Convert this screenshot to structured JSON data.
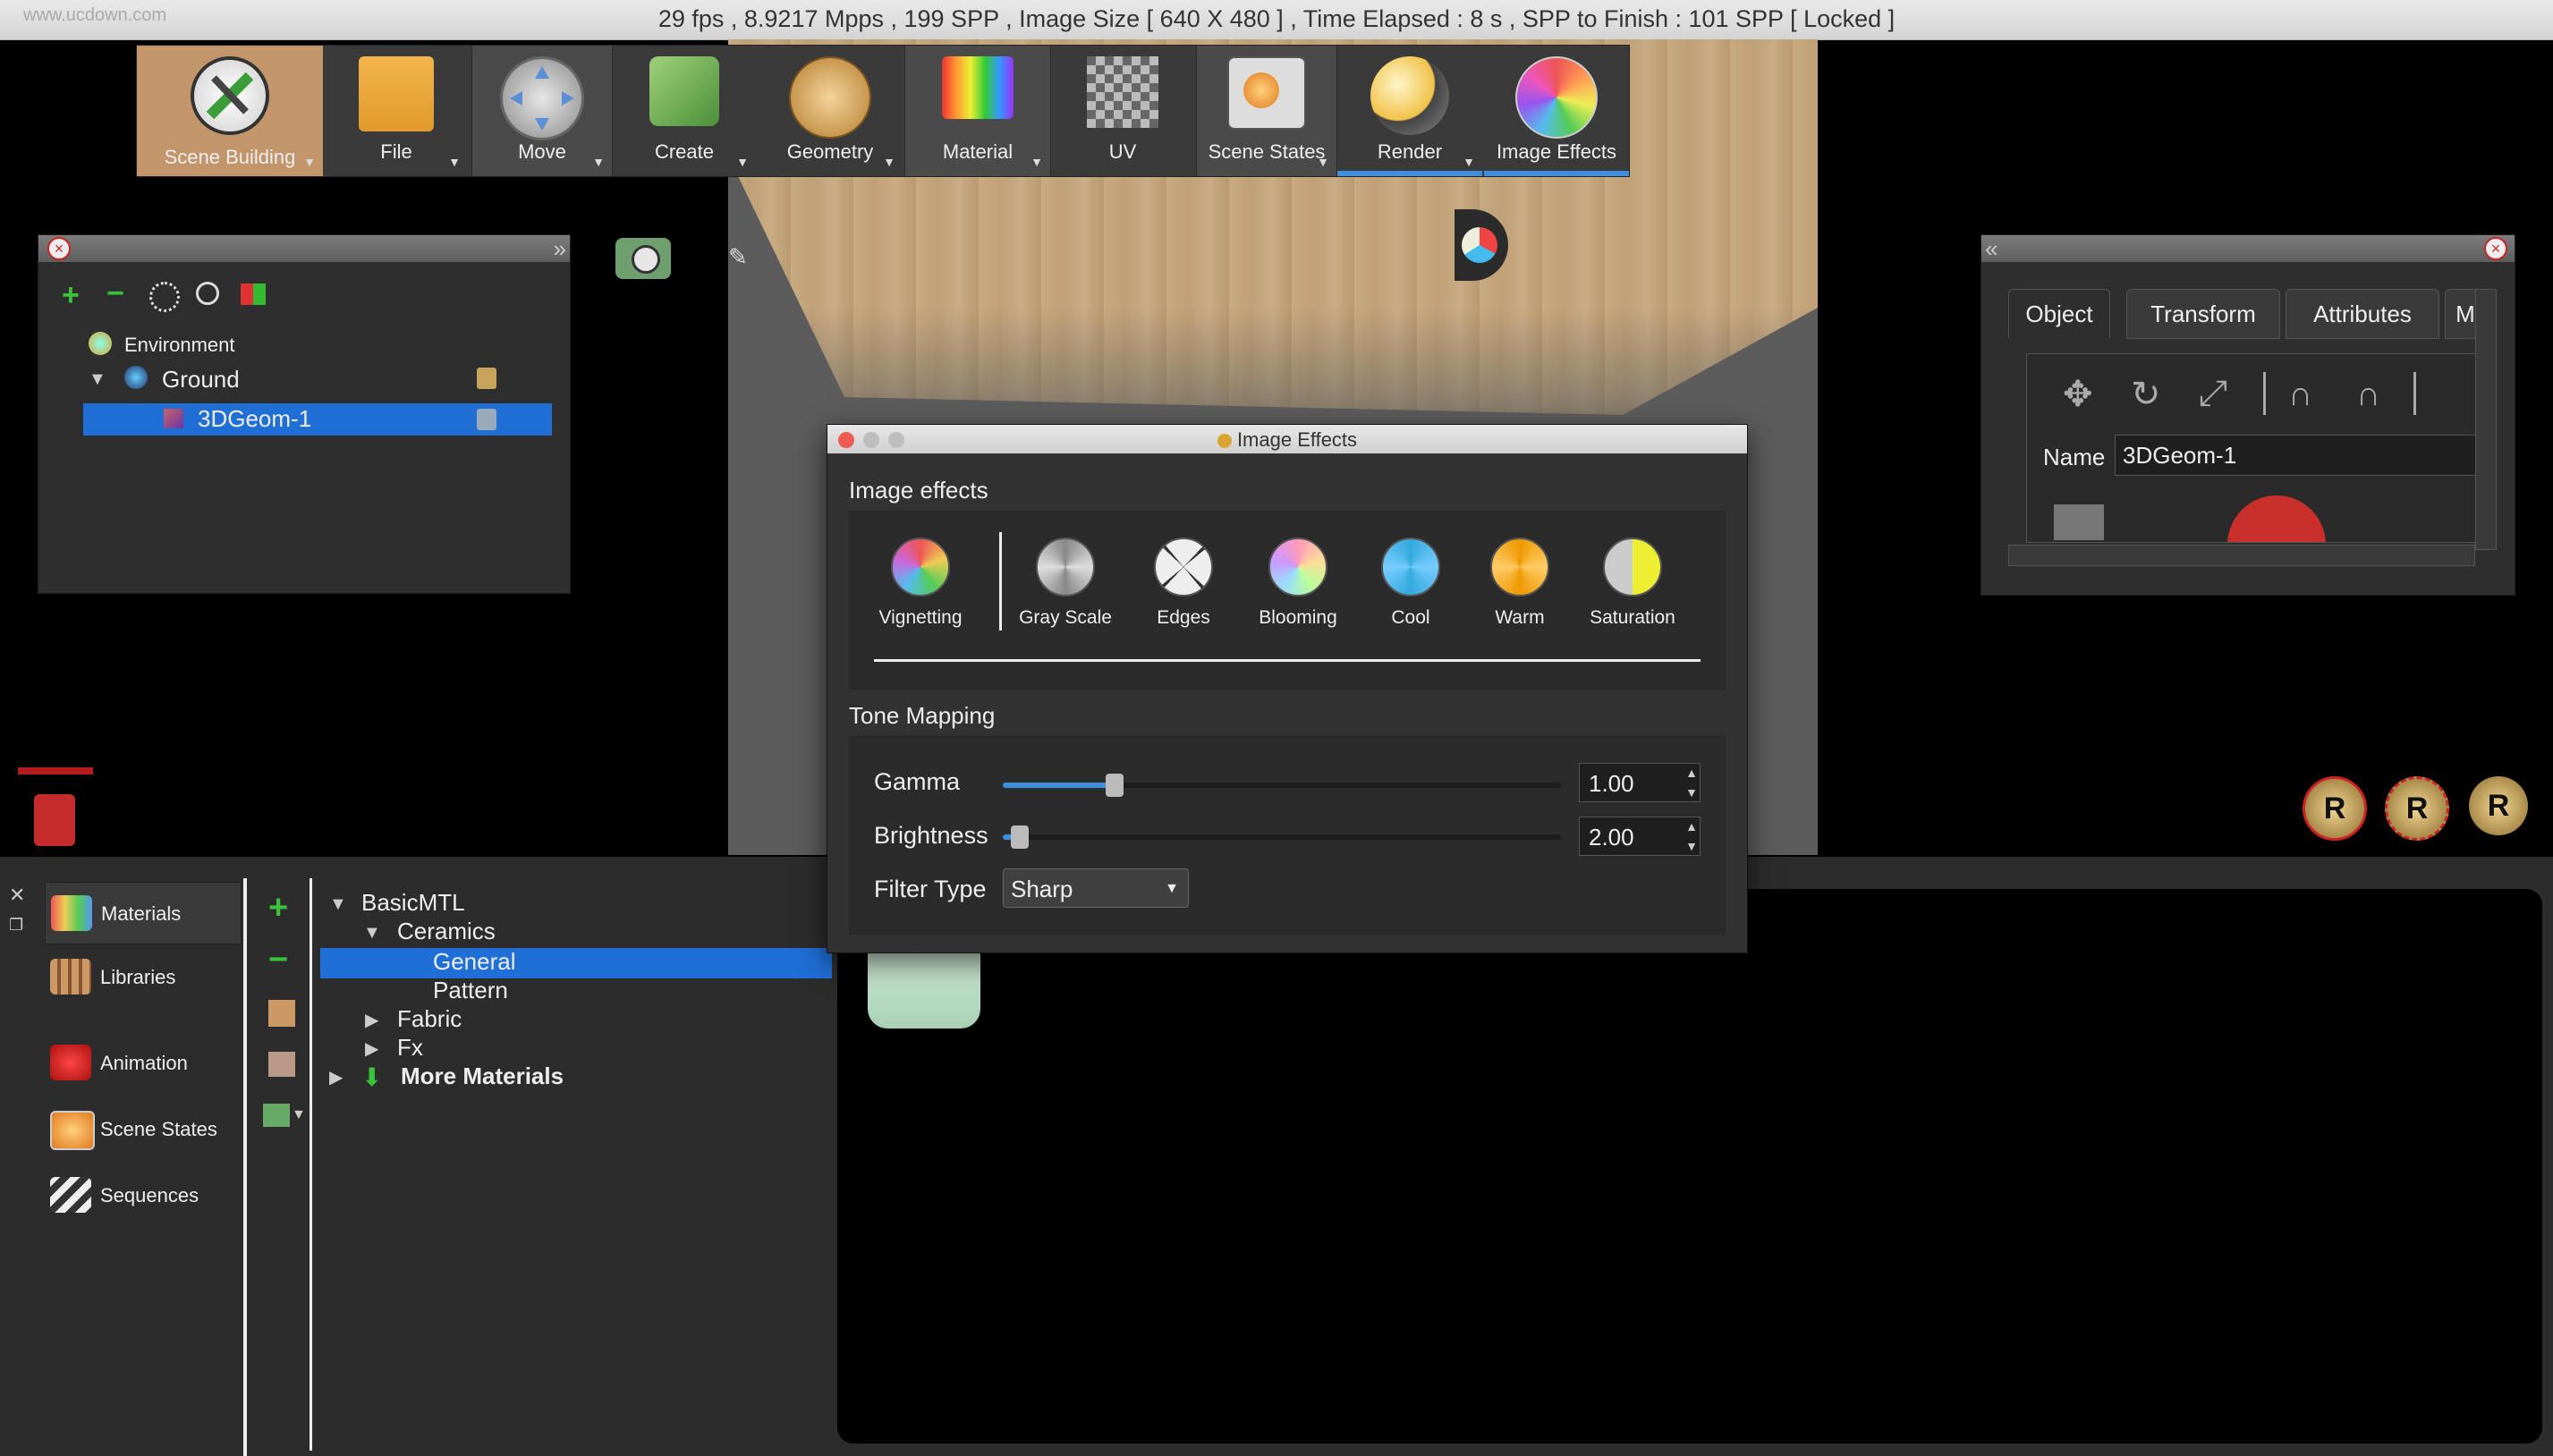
{
  "titlebar": {
    "watermark": "www.ucdown.com",
    "status": "29 fps ,  8.9217 Mpps  ,  199 SPP    ,  Image Size [ 640 X 480 ] , Time Elapsed : 8 s , SPP to Finish : 101 SPP  [ Locked ]"
  },
  "toolbar": {
    "items": [
      {
        "label": "Scene Building",
        "icon": "hammer-pencil-icon"
      },
      {
        "label": "File",
        "icon": "folder-icon"
      },
      {
        "label": "Move",
        "icon": "move-arrows-icon"
      },
      {
        "label": "Create",
        "icon": "cube-pencil-icon"
      },
      {
        "label": "Geometry",
        "icon": "geodesic-sphere-icon"
      },
      {
        "label": "Material",
        "icon": "paint-palette-icon"
      },
      {
        "label": "UV",
        "icon": "uv-checker-icon"
      },
      {
        "label": "Scene States",
        "icon": "scene-states-icon"
      },
      {
        "label": "Render",
        "icon": "render-sphere-icon"
      },
      {
        "label": "Image Effects",
        "icon": "color-wheel-icon"
      }
    ]
  },
  "scene_tree": {
    "items": [
      {
        "label": "Environment"
      },
      {
        "label": "Ground"
      },
      {
        "label": "3DGeom-1"
      }
    ]
  },
  "object_panel": {
    "tabs": [
      "Object",
      "Transform",
      "Attributes",
      "M"
    ],
    "name_label": "Name",
    "name_value": "3DGeom-1"
  },
  "image_effects": {
    "window_title": "Image Effects",
    "section_effects": "Image effects",
    "effects": [
      {
        "label": "Vignetting",
        "color": "#c46bd6"
      },
      {
        "label": "Gray Scale",
        "color": "#9a9a9a"
      },
      {
        "label": "Edges",
        "color": "#cfcfcf"
      },
      {
        "label": "Blooming",
        "color": "#f4a3c8"
      },
      {
        "label": "Cool",
        "color": "#4fb8e8"
      },
      {
        "label": "Warm",
        "color": "#f0a040"
      },
      {
        "label": "Saturation",
        "color": "#e8d930"
      }
    ],
    "section_tone": "Tone Mapping",
    "gamma_label": "Gamma",
    "gamma_value": "1.00",
    "gamma_level": 0.2,
    "brightness_label": "Brightness",
    "brightness_value": "2.00",
    "brightness_level": 0.03,
    "filter_label": "Filter Type",
    "filter_value": "Sharp"
  },
  "left_nav": {
    "items": [
      {
        "label": "Materials"
      },
      {
        "label": "Libraries"
      },
      {
        "label": "Animation"
      },
      {
        "label": "Scene States"
      },
      {
        "label": "Sequences"
      }
    ]
  },
  "materials_tree": {
    "items": [
      {
        "label": "BasicMTL"
      },
      {
        "label": "Ceramics"
      },
      {
        "label": "General"
      },
      {
        "label": "Pattern"
      },
      {
        "label": "Fabric"
      },
      {
        "label": "Fx"
      },
      {
        "label": "More Materials"
      }
    ]
  },
  "colors": {
    "accent": "#1f6fd6",
    "active_tool": "#c3956a",
    "close_red": "#c92525"
  }
}
